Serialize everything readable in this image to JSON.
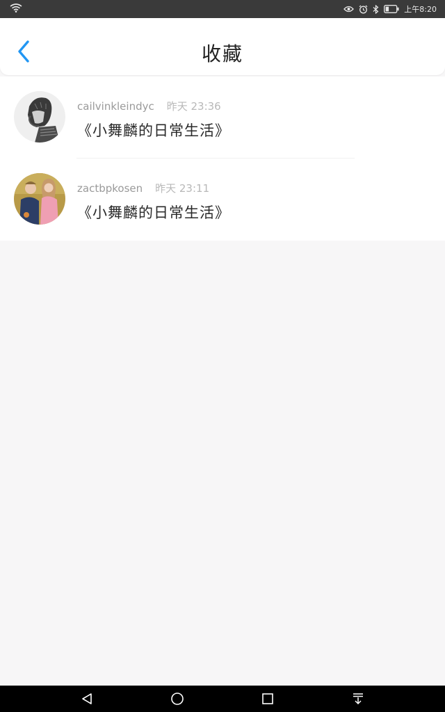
{
  "status_bar": {
    "time": "上午8:20",
    "icons": [
      "wifi-icon",
      "eye-icon",
      "alarm-icon",
      "bluetooth-icon",
      "battery-icon"
    ]
  },
  "header": {
    "title": "收藏",
    "back_icon": "chevron-left-icon",
    "accent_color": "#2196f3"
  },
  "favorites": [
    {
      "username": "cailvinkleindyc",
      "time": "昨天 23:36",
      "title": "《小舞麟的日常生活》",
      "avatar": "sketch-portrait-avatar"
    },
    {
      "username": "zactbpkosen",
      "time": "昨天 23:11",
      "title": "《小舞麟的日常生活》",
      "avatar": "couple-photo-avatar"
    }
  ],
  "nav_bar": {
    "icons": [
      "back-triangle-icon",
      "home-circle-icon",
      "recents-square-icon",
      "notification-pulldown-icon"
    ]
  }
}
